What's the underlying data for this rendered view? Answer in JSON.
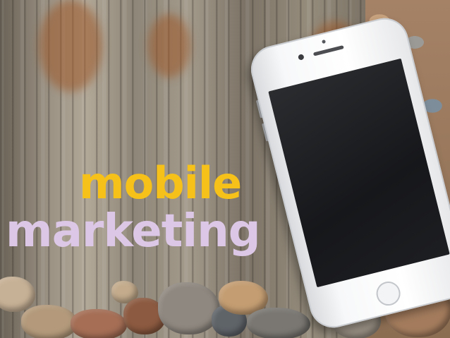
{
  "caption": {
    "line1": "mobile",
    "line2": "marketing"
  },
  "colors": {
    "line1": "#f6c21a",
    "line2": "#dcc8e6",
    "wood": "#9a9183",
    "phone": "#f4f5f6",
    "screen": "#1c1d20"
  },
  "objects": [
    "wooden-post",
    "smartphone",
    "pebbles"
  ]
}
